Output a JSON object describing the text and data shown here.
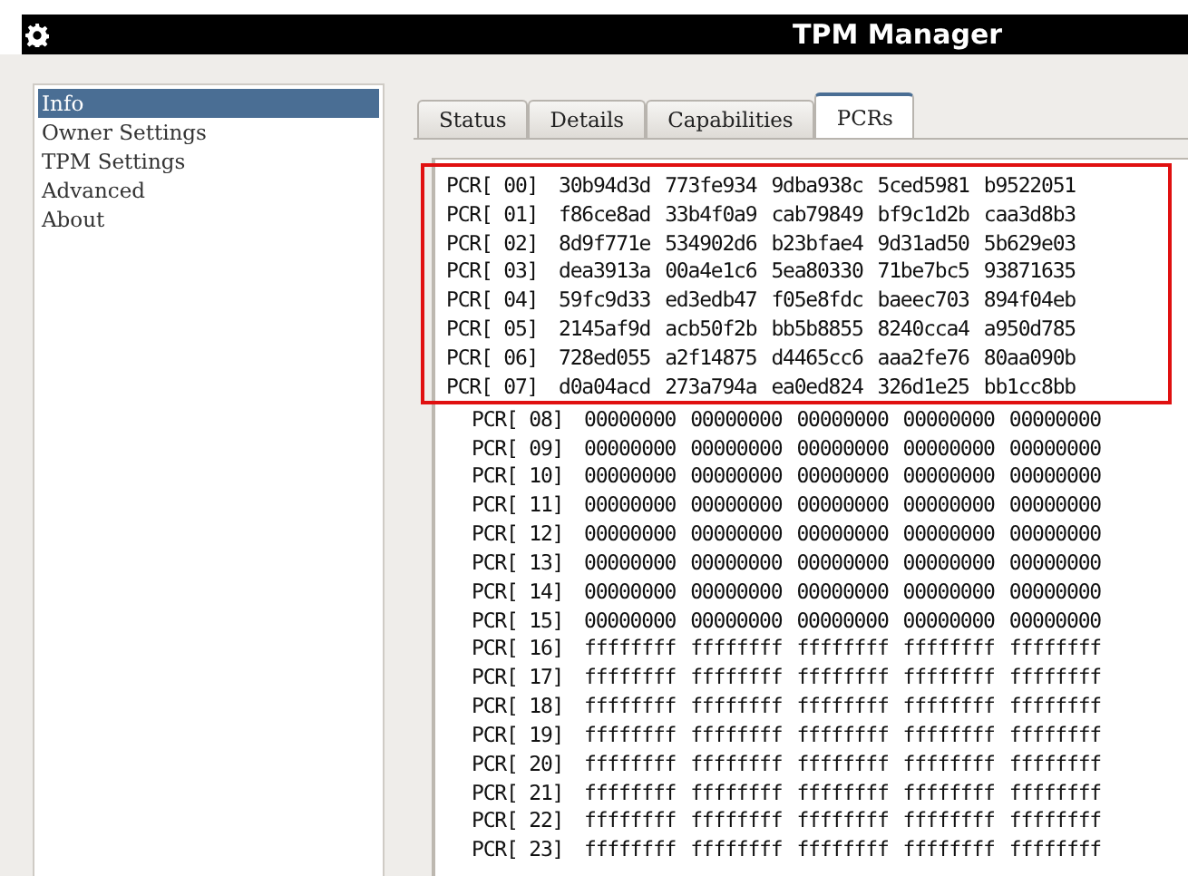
{
  "window": {
    "title": "TPM Manager"
  },
  "sidebar": {
    "items": [
      {
        "label": "Info",
        "selected": true
      },
      {
        "label": "Owner Settings",
        "selected": false
      },
      {
        "label": "TPM Settings",
        "selected": false
      },
      {
        "label": "Advanced",
        "selected": false
      },
      {
        "label": "About",
        "selected": false
      }
    ]
  },
  "tabs": [
    {
      "label": "Status",
      "selected": false
    },
    {
      "label": "Details",
      "selected": false
    },
    {
      "label": "Capabilities",
      "selected": false
    },
    {
      "label": "PCRs",
      "selected": true
    }
  ],
  "pcr_groups": [
    {
      "boxed": true,
      "rows": [
        {
          "label": "PCR[ 00]",
          "values": [
            "30b94d3d",
            "773fe934",
            "9dba938c",
            "5ced5981",
            "b9522051"
          ]
        },
        {
          "label": "PCR[ 01]",
          "values": [
            "f86ce8ad",
            "33b4f0a9",
            "cab79849",
            "bf9c1d2b",
            "caa3d8b3"
          ]
        },
        {
          "label": "PCR[ 02]",
          "values": [
            "8d9f771e",
            "534902d6",
            "b23bfae4",
            "9d31ad50",
            "5b629e03"
          ]
        },
        {
          "label": "PCR[ 03]",
          "values": [
            "dea3913a",
            "00a4e1c6",
            "5ea80330",
            "71be7bc5",
            "93871635"
          ]
        },
        {
          "label": "PCR[ 04]",
          "values": [
            "59fc9d33",
            "ed3edb47",
            "f05e8fdc",
            "baeec703",
            "894f04eb"
          ]
        },
        {
          "label": "PCR[ 05]",
          "values": [
            "2145af9d",
            "acb50f2b",
            "bb5b8855",
            "8240cca4",
            "a950d785"
          ]
        },
        {
          "label": "PCR[ 06]",
          "values": [
            "728ed055",
            "a2f14875",
            "d4465cc6",
            "aaa2fe76",
            "80aa090b"
          ]
        },
        {
          "label": "PCR[ 07]",
          "values": [
            "d0a04acd",
            "273a794a",
            "ea0ed824",
            "326d1e25",
            "bb1cc8bb"
          ]
        }
      ]
    },
    {
      "boxed": false,
      "rows": [
        {
          "label": "PCR[ 08]",
          "values": [
            "00000000",
            "00000000",
            "00000000",
            "00000000",
            "00000000"
          ]
        },
        {
          "label": "PCR[ 09]",
          "values": [
            "00000000",
            "00000000",
            "00000000",
            "00000000",
            "00000000"
          ]
        },
        {
          "label": "PCR[ 10]",
          "values": [
            "00000000",
            "00000000",
            "00000000",
            "00000000",
            "00000000"
          ]
        },
        {
          "label": "PCR[ 11]",
          "values": [
            "00000000",
            "00000000",
            "00000000",
            "00000000",
            "00000000"
          ]
        },
        {
          "label": "PCR[ 12]",
          "values": [
            "00000000",
            "00000000",
            "00000000",
            "00000000",
            "00000000"
          ]
        },
        {
          "label": "PCR[ 13]",
          "values": [
            "00000000",
            "00000000",
            "00000000",
            "00000000",
            "00000000"
          ]
        },
        {
          "label": "PCR[ 14]",
          "values": [
            "00000000",
            "00000000",
            "00000000",
            "00000000",
            "00000000"
          ]
        },
        {
          "label": "PCR[ 15]",
          "values": [
            "00000000",
            "00000000",
            "00000000",
            "00000000",
            "00000000"
          ]
        },
        {
          "label": "PCR[ 16]",
          "values": [
            "ffffffff",
            "ffffffff",
            "ffffffff",
            "ffffffff",
            "ffffffff"
          ]
        },
        {
          "label": "PCR[ 17]",
          "values": [
            "ffffffff",
            "ffffffff",
            "ffffffff",
            "ffffffff",
            "ffffffff"
          ]
        },
        {
          "label": "PCR[ 18]",
          "values": [
            "ffffffff",
            "ffffffff",
            "ffffffff",
            "ffffffff",
            "ffffffff"
          ]
        },
        {
          "label": "PCR[ 19]",
          "values": [
            "ffffffff",
            "ffffffff",
            "ffffffff",
            "ffffffff",
            "ffffffff"
          ]
        },
        {
          "label": "PCR[ 20]",
          "values": [
            "ffffffff",
            "ffffffff",
            "ffffffff",
            "ffffffff",
            "ffffffff"
          ]
        },
        {
          "label": "PCR[ 21]",
          "values": [
            "ffffffff",
            "ffffffff",
            "ffffffff",
            "ffffffff",
            "ffffffff"
          ]
        },
        {
          "label": "PCR[ 22]",
          "values": [
            "ffffffff",
            "ffffffff",
            "ffffffff",
            "ffffffff",
            "ffffffff"
          ]
        },
        {
          "label": "PCR[ 23]",
          "values": [
            "ffffffff",
            "ffffffff",
            "ffffffff",
            "ffffffff",
            "ffffffff"
          ]
        }
      ]
    }
  ]
}
